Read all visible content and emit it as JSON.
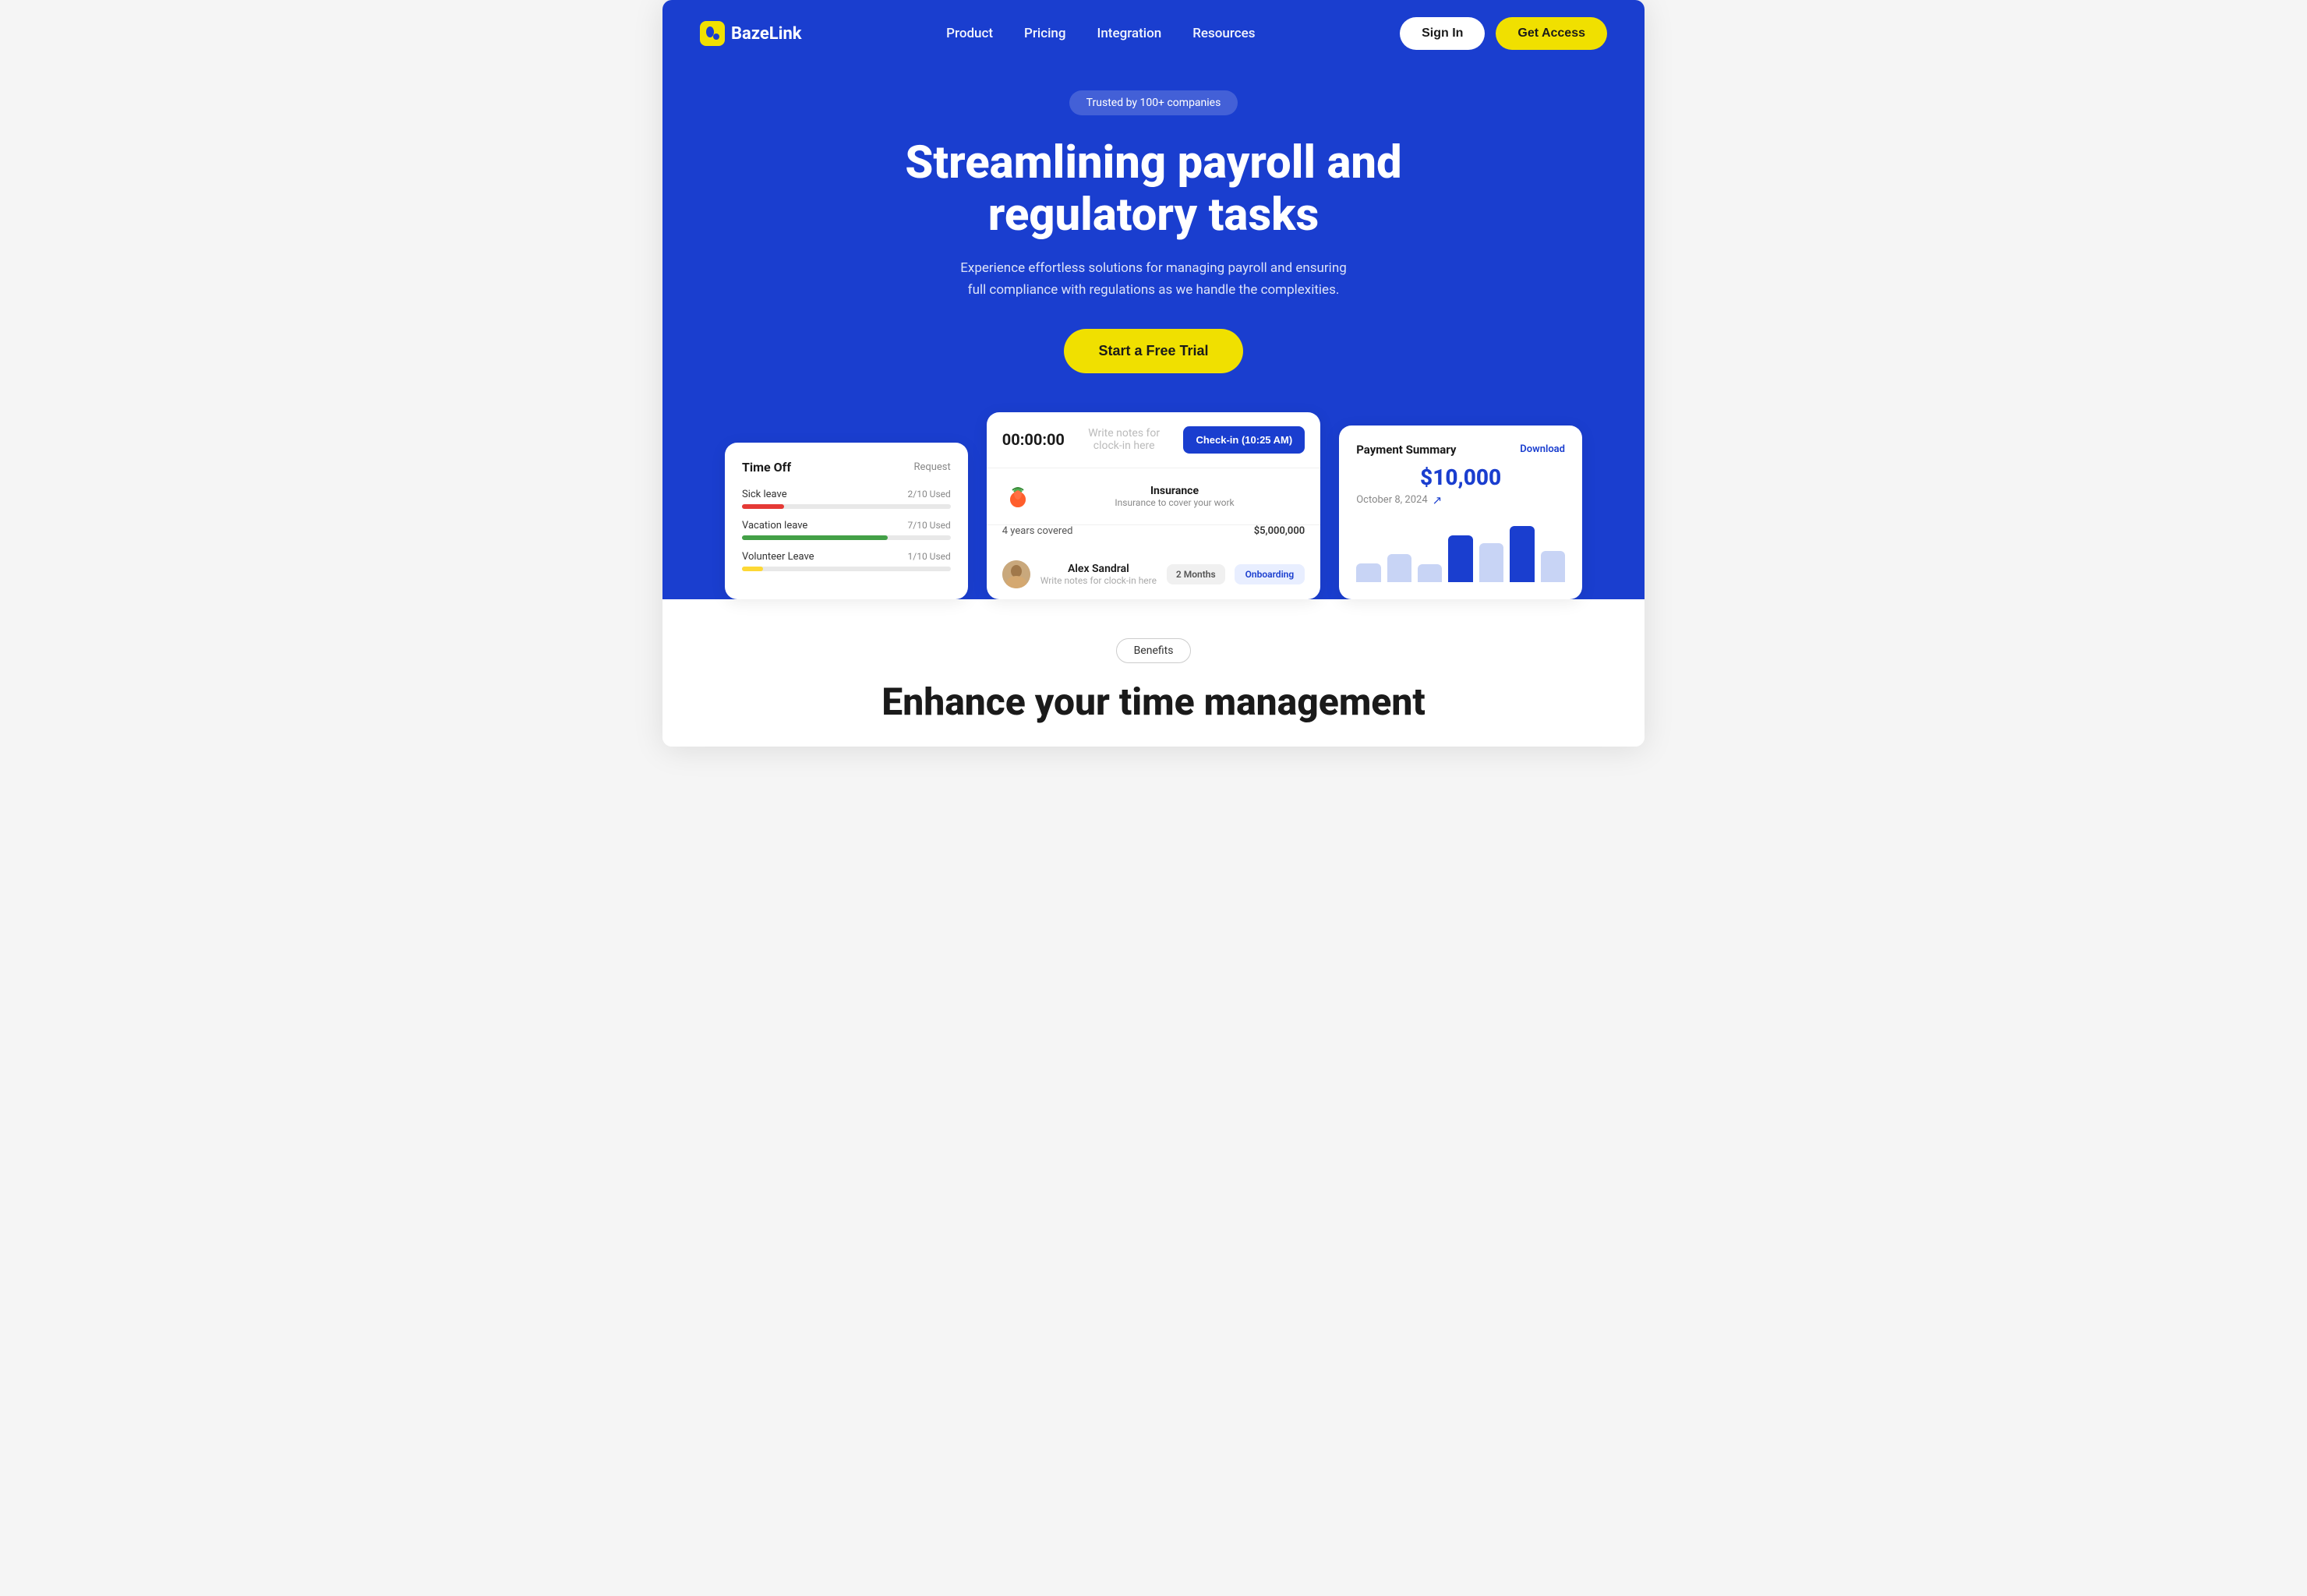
{
  "brand": {
    "name": "BazeLink",
    "logo_emoji": "🟡"
  },
  "navbar": {
    "links": [
      {
        "label": "Product",
        "href": "#"
      },
      {
        "label": "Pricing",
        "href": "#"
      },
      {
        "label": "Integration",
        "href": "#"
      },
      {
        "label": "Resources",
        "href": "#"
      }
    ],
    "signin_label": "Sign In",
    "getaccess_label": "Get Access"
  },
  "hero": {
    "trusted_badge": "Trusted by 100+ companies",
    "title": "Streamlining payroll and regulatory tasks",
    "subtitle": "Experience effortless solutions for managing payroll and ensuring full compliance with regulations as we handle the complexities.",
    "cta_label": "Start a Free Trial"
  },
  "time_off_card": {
    "title": "Time Off",
    "action": "Request",
    "items": [
      {
        "name": "Sick leave",
        "used": "2/10 Used",
        "percent": 20,
        "color": "#e53935"
      },
      {
        "name": "Vacation leave",
        "used": "7/10 Used",
        "percent": 70,
        "color": "#43a047"
      },
      {
        "name": "Volunteer Leave",
        "used": "1/10 Used",
        "percent": 10,
        "color": "#fdd835"
      }
    ]
  },
  "clock_card": {
    "time": "00:00:00",
    "note_placeholder": "Write notes for clock-in here",
    "checkin_label": "Check-in (10:25 AM)",
    "insurance": {
      "title": "Insurance",
      "subtitle": "Insurance to cover your work",
      "years": "4 years covered",
      "amount": "$5,000,000"
    },
    "employee": {
      "name": "Alex Sandral",
      "note": "Write notes for clock-in here",
      "badge_months": "2 Months",
      "badge_status": "Onboarding"
    }
  },
  "payment_card": {
    "title": "Payment Summary",
    "download_label": "Download",
    "amount": "$10,000",
    "date": "October 8, 2024",
    "chart_bars": [
      30,
      40,
      25,
      65,
      55,
      80,
      45
    ]
  },
  "benefits": {
    "badge": "Benefits",
    "title": "Enhance your time management"
  },
  "colors": {
    "primary": "#1a3ecf",
    "accent": "#f0e000",
    "hero_bg": "#1a3ecf"
  }
}
